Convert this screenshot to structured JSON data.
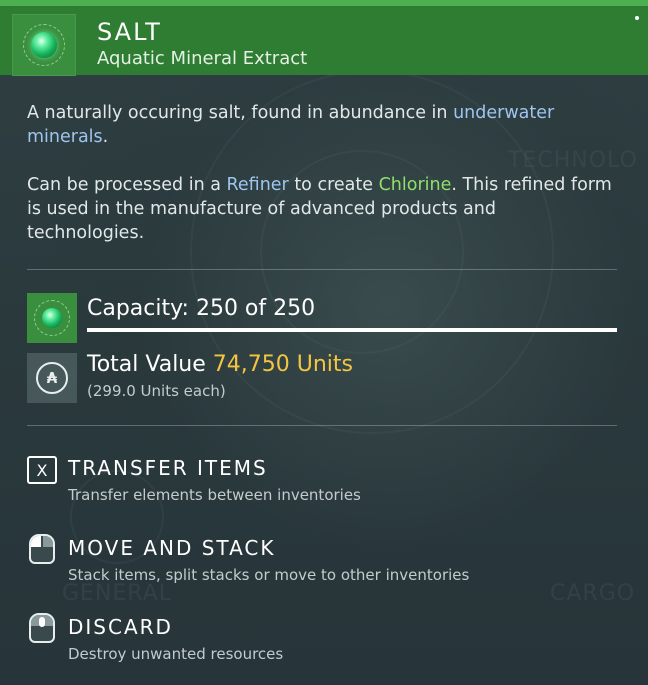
{
  "item": {
    "name": "SALT",
    "category": "Aquatic Mineral Extract",
    "icon": "green-orb-icon"
  },
  "description": {
    "p1_a": "A naturally occuring salt, found in abundance in ",
    "p1_link": "underwater minerals",
    "p1_b": ".",
    "p2_a": "Can be processed in a ",
    "p2_link1": "Refiner",
    "p2_b": " to create ",
    "p2_link2": "Chlorine",
    "p2_c": ". This refined form is used in the manufacture of advanced products and technologies."
  },
  "capacity": {
    "label": "Capacity: 250 of 250",
    "fill": 1.0
  },
  "value": {
    "label": "Total Value ",
    "amount": "74,750 Units",
    "each": "(299.0 Units each)"
  },
  "actions": [
    {
      "key": "X",
      "title": "TRANSFER ITEMS",
      "subtitle": "Transfer elements between inventories",
      "icon": "x-key-icon"
    },
    {
      "title": "MOVE AND STACK",
      "subtitle": "Stack items, split stacks or move to other inventories",
      "icon": "mouse-left-click-icon"
    },
    {
      "title": "DISCARD",
      "subtitle": "Destroy unwanted resources",
      "icon": "mouse-middle-click-icon"
    }
  ],
  "background_labels": {
    "tech": "TECHNOLO",
    "general": "GENERAL",
    "cargo": "CARGO"
  },
  "colors": {
    "header": "#2e7d32",
    "link_blue": "#9ec5ef",
    "link_green": "#8fe06b",
    "units_gold": "#f5c542"
  }
}
